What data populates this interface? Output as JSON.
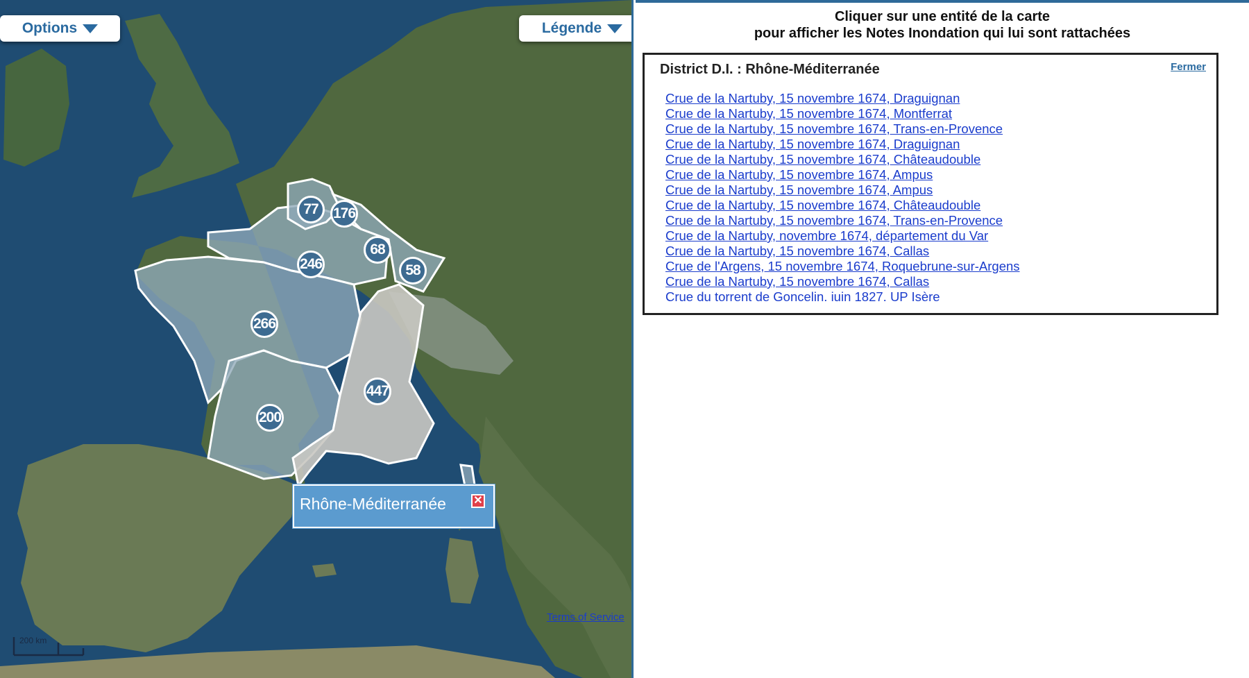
{
  "map": {
    "options_label": "Options",
    "legend_label": "Légende",
    "clusters": [
      {
        "count": "77",
        "region": "hauts-de-france"
      },
      {
        "count": "176",
        "region": "rhin-meuse"
      },
      {
        "count": "68",
        "region": "lorraine"
      },
      {
        "count": "58",
        "region": "alsace"
      },
      {
        "count": "246",
        "region": "seine-normandie"
      },
      {
        "count": "266",
        "region": "loire-bretagne"
      },
      {
        "count": "447",
        "region": "rhone-mediterranee"
      },
      {
        "count": "200",
        "region": "adour-garonne"
      }
    ],
    "popup": {
      "title": "Rhône-Méditerranée",
      "close_icon": "close-icon"
    },
    "terms_label": "Terms of Service",
    "scale_label": "200 km",
    "colors": {
      "sea": "#1f4c72",
      "land": "#4a6a45",
      "region_fill": "#8fa9b8",
      "selected_fill": "#c9c8c2",
      "cluster": "#3d6b91",
      "popup": "#5b9bcf"
    }
  },
  "panel": {
    "instruction_line1": "Cliquer sur une entité de la carte",
    "instruction_line2": "pour afficher les Notes Inondation qui lui sont rattachées",
    "result": {
      "title": "District D.I. : Rhône-Méditerranée",
      "close_label": "Fermer",
      "items": [
        {
          "text": "Crue de la Nartuby, 15 novembre 1674, Draguignan",
          "link": true
        },
        {
          "text": "Crue de la Nartuby, 15 novembre 1674, Montferrat",
          "link": true
        },
        {
          "text": "Crue de la Nartuby, 15 novembre 1674, Trans-en-Provence",
          "link": true
        },
        {
          "text": "Crue de la Nartuby, 15 novembre 1674, Draguignan",
          "link": true
        },
        {
          "text": "Crue de la Nartuby, 15 novembre 1674, Châteaudouble",
          "link": true
        },
        {
          "text": "Crue de la Nartuby, 15 novembre 1674, Ampus",
          "link": true
        },
        {
          "text": "Crue de la Nartuby, 15 novembre 1674, Ampus",
          "link": true
        },
        {
          "text": "Crue de la Nartuby, 15 novembre 1674, Châteaudouble",
          "link": true
        },
        {
          "text": "Crue de la Nartuby, 15 novembre 1674, Trans-en-Provence",
          "link": true
        },
        {
          "text": "Crue de la Nartuby, novembre 1674, département du Var",
          "link": true
        },
        {
          "text": "Crue de la Nartuby, 15 novembre 1674, Callas",
          "link": true
        },
        {
          "text": "Crue de l'Argens, 15 novembre 1674, Roquebrune-sur-Argens",
          "link": true
        },
        {
          "text": "Crue de la Nartuby, 15 novembre 1674, Callas",
          "link": true
        },
        {
          "text": "Crue du torrent de Goncelin. iuin 1827. UP Isère",
          "link": false
        }
      ]
    }
  }
}
